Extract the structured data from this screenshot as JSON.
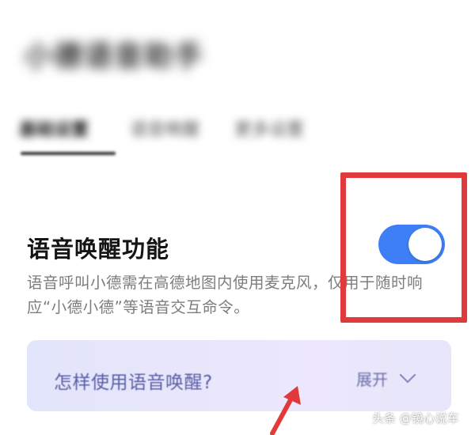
{
  "header": {
    "title": "小德语音助手",
    "tabs": [
      {
        "label": "基础设置",
        "active": true
      },
      {
        "label": "语音唤醒",
        "active": false
      },
      {
        "label": "更多设置",
        "active": false
      }
    ]
  },
  "voice_wake": {
    "title": "语音唤醒功能",
    "description": "语音呼叫小德需在高德地图内使用麦克风，仅用于随时响应“小德小德”等语音交互命令。",
    "toggle_on": true
  },
  "howto": {
    "question": "怎样使用语音唤醒?",
    "expand_label": "展开",
    "chevron_icon": "chevron-down-icon"
  },
  "watermark": "头条 @镜心说车",
  "colors": {
    "accent_blue": "#3f7ff5",
    "annotation_red": "#e03a3a",
    "panel_text": "#5a5fa8"
  }
}
